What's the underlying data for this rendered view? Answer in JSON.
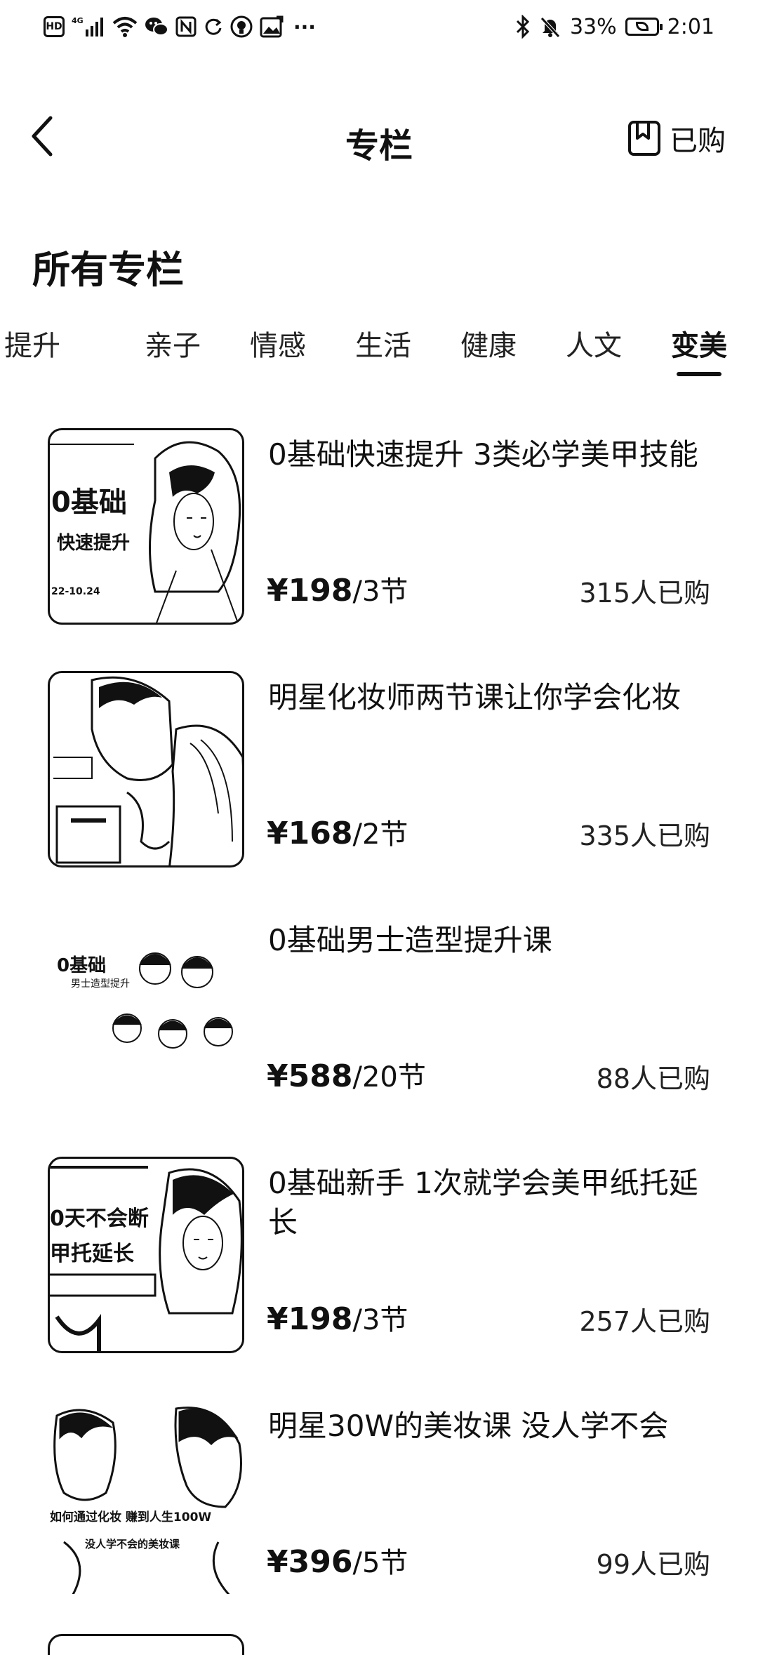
{
  "status_bar": {
    "left_icons": [
      "hd-icon",
      "signal-4g-icon",
      "wifi-icon",
      "wechat-icon",
      "nfc-icon",
      "sync-icon",
      "app-icon",
      "image-icon"
    ],
    "network_label": "4G",
    "more": "···",
    "battery_percent": "33%",
    "time": "2:01"
  },
  "nav": {
    "title": "专栏",
    "purchased_label": "已购"
  },
  "section": {
    "title": "所有专栏"
  },
  "tabs": [
    {
      "label": "提升",
      "active": false
    },
    {
      "label": "亲子",
      "active": false
    },
    {
      "label": "情感",
      "active": false
    },
    {
      "label": "生活",
      "active": false
    },
    {
      "label": "健康",
      "active": false
    },
    {
      "label": "人文",
      "active": false
    },
    {
      "label": "变美",
      "active": true
    }
  ],
  "courses": [
    {
      "title": "0基础快速提升 3类必学美甲技能",
      "price": "¥198",
      "lessons": "/3节",
      "buyers": "315人已购",
      "thumb_text": [
        "0基础",
        "快速提升",
        "22-10.24"
      ]
    },
    {
      "title": "明星化妆师两节课让你学会化妆",
      "price": "¥168",
      "lessons": "/2节",
      "buyers": "335人已购",
      "thumb_text": []
    },
    {
      "title": "0基础男士造型提升课",
      "price": "¥588",
      "lessons": "/20节",
      "buyers": "88人已购",
      "thumb_text": [
        "0基础",
        "男士造型提升"
      ]
    },
    {
      "title": "0基础新手 1次就学会美甲纸托延长",
      "price": "¥198",
      "lessons": "/3节",
      "buyers": "257人已购",
      "thumb_text": [
        "0天不会断",
        "甲托延长"
      ]
    },
    {
      "title": "明星30W的美妆课 没人学不会",
      "price": "¥396",
      "lessons": "/5节",
      "buyers": "99人已购",
      "thumb_text": [
        "如何通过化妆 赚到人生100W",
        "没人学不会的美妆课"
      ]
    }
  ]
}
